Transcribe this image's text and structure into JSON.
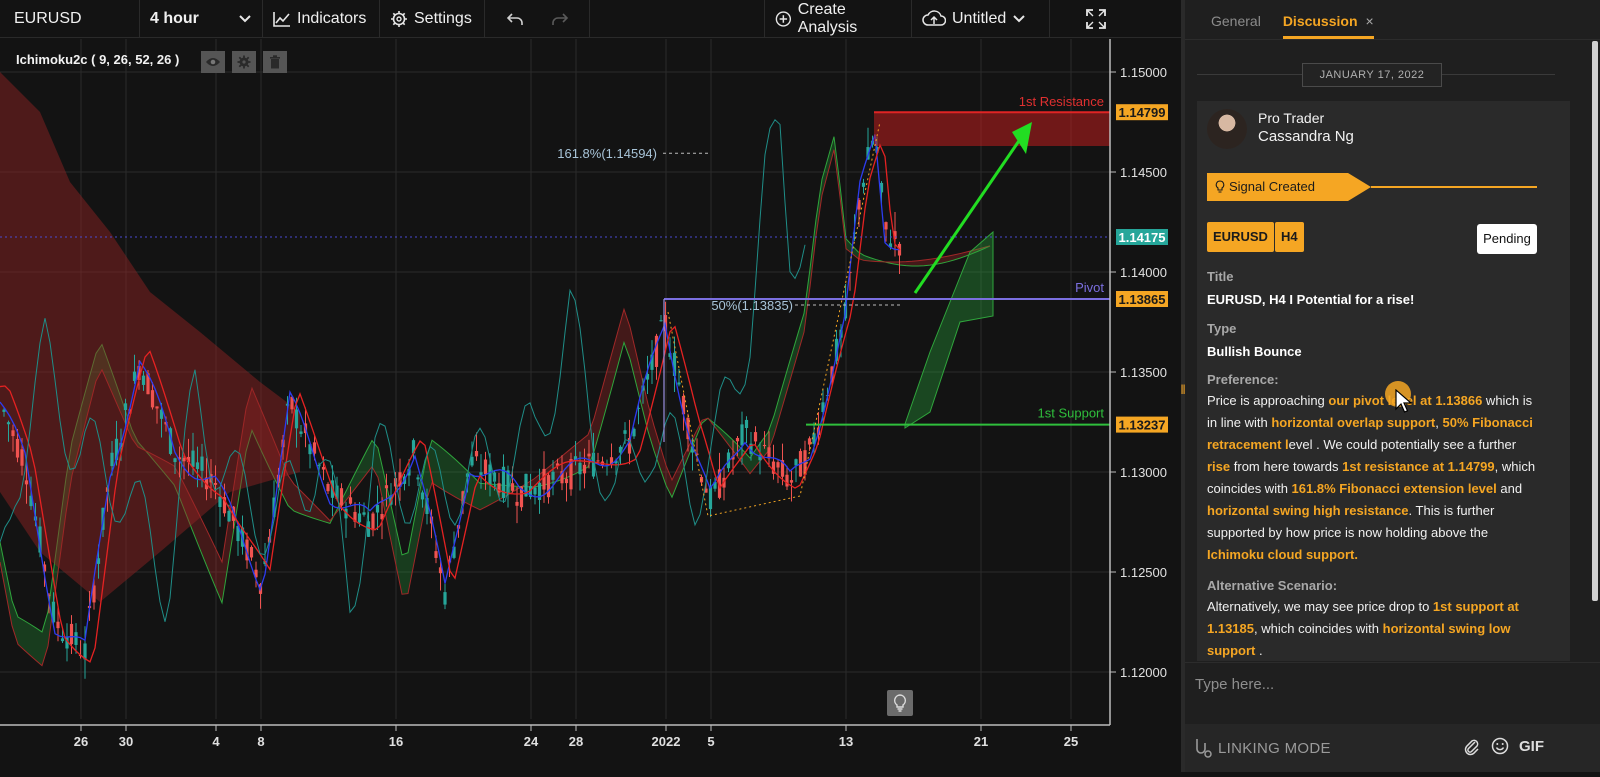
{
  "toolbar": {
    "symbol": "EURUSD",
    "interval": "4 hour",
    "indicators_label": "Indicators",
    "settings_label": "Settings",
    "create_analysis_label": "Create Analysis",
    "layout_name": "Untitled",
    "icons": [
      "chevron-down-icon",
      "line-chart-icon",
      "gear-icon",
      "undo-icon",
      "redo-icon",
      "plus-circle-icon",
      "cloud-upload-icon",
      "fullscreen-icon"
    ]
  },
  "chart": {
    "indicator_label": "Ichimoku2c ( 9, 26, 52, 26 )",
    "indicator_icons": [
      "eye-icon",
      "gear-icon",
      "trash-icon"
    ],
    "price_axis": [
      "1.15000",
      "1.14500",
      "1.14000",
      "1.13500",
      "1.13000",
      "1.12500",
      "1.12000"
    ],
    "time_axis": [
      "26",
      "30",
      "4",
      "8",
      "16",
      "24",
      "28",
      "2022",
      "5",
      "13",
      "21",
      "25"
    ],
    "levels": {
      "resistance": {
        "name": "1st Resistance",
        "price": "1.14799",
        "color": "#e02424"
      },
      "current": {
        "price": "1.14175",
        "color": "#26a69a"
      },
      "pivot": {
        "name": "Pivot",
        "price": "1.13865",
        "color": "#7b6fe0"
      },
      "support": {
        "name": "1st Support",
        "price": "1.13237",
        "color": "#2fbf3c"
      }
    },
    "fib_labels": {
      "extension": "161.8%(1.14594)",
      "retracement": "50%(1.13835)"
    },
    "colors": {
      "bull": "#26a69a",
      "bear": "#ef5350",
      "arrow": "#22dd22"
    }
  },
  "panel": {
    "tabs": [
      "General",
      "Discussion"
    ],
    "close_icon": "×",
    "date": "JANUARY 17, 2022",
    "post": {
      "role": "Pro Trader",
      "author": "Cassandra Ng",
      "signal": "Signal Created",
      "symbol_chip": "EURUSD",
      "interval_chip": "H4",
      "status": "Pending",
      "title_label": "Title",
      "title": "EURUSD, H4 I Potential for a rise!",
      "type_label": "Type",
      "type": "Bullish Bounce",
      "preference_label": "Preference:",
      "preference": [
        {
          "t": "Price is approaching ",
          "hl": false
        },
        {
          "t": "our pivot level at 1.13866",
          "hl": true
        },
        {
          "t": " which is in line with ",
          "hl": false
        },
        {
          "t": "horizontal overlap support",
          "hl": true
        },
        {
          "t": ", ",
          "hl": false
        },
        {
          "t": "50% Fibonacci retracement l",
          "hl": true
        },
        {
          "t": "evel . We could potentially see a further ",
          "hl": false
        },
        {
          "t": "rise",
          "hl": true
        },
        {
          "t": " from here towards ",
          "hl": false
        },
        {
          "t": "1st resistance at 1.14799",
          "hl": true
        },
        {
          "t": ", which coincides with ",
          "hl": false
        },
        {
          "t": "161.8% Fibonacci extension level",
          "hl": true
        },
        {
          "t": " and ",
          "hl": false
        },
        {
          "t": "horizontal swing high resistance",
          "hl": true
        },
        {
          "t": ". This is further supported by how price is now holding above the ",
          "hl": false
        },
        {
          "t": "Ichimoku cloud support.",
          "hl": true
        }
      ],
      "alternative_label": "Alternative Scenario:",
      "alternative": [
        {
          "t": "Alternatively, we may see price drop to ",
          "hl": false
        },
        {
          "t": "1st support at 1.13185",
          "hl": true
        },
        {
          "t": ", which coincides with ",
          "hl": false
        },
        {
          "t": "horizontal swing low support",
          "hl": true
        },
        {
          "t": " .",
          "hl": false
        }
      ]
    },
    "input_placeholder": "Type here...",
    "linking_mode": "LINKING MODE",
    "gif_label": "GIF"
  }
}
